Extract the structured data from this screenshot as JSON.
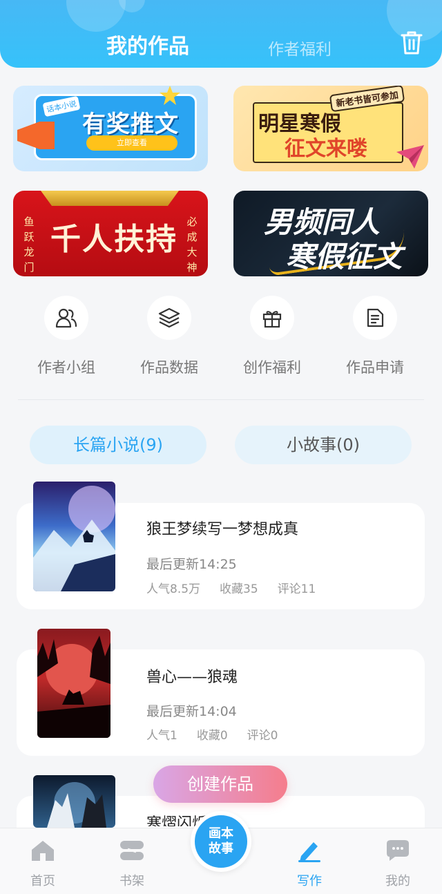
{
  "header": {
    "tab_active": "我的作品",
    "tab_inactive": "作者福利",
    "trash_icon": "trash-icon"
  },
  "banners": [
    {
      "id": "award",
      "tag": "话本小说",
      "title": "有奖推文",
      "button": "立即查看"
    },
    {
      "id": "star",
      "ribbon": "新老书皆可参加",
      "line1": "明星寒假",
      "line2": "征文来喽"
    },
    {
      "id": "support",
      "title": "千人扶持",
      "left_side": "鱼跃龙门",
      "right_side": "必成大神"
    },
    {
      "id": "fanfic",
      "line1": "男频同人",
      "line2": "寒假征文"
    }
  ],
  "features": [
    {
      "label": "作者小组",
      "icon": "users-icon"
    },
    {
      "label": "作品数据",
      "icon": "layers-icon"
    },
    {
      "label": "创作福利",
      "icon": "gift-icon"
    },
    {
      "label": "作品申请",
      "icon": "document-icon"
    }
  ],
  "categories": [
    {
      "label": "长篇小说(9)",
      "active": true
    },
    {
      "label": "小故事(0)",
      "active": false
    }
  ],
  "works": [
    {
      "title": "狼王梦续写一梦想成真",
      "updated": "最后更新14:25",
      "popularity": "人气8.5万",
      "favorites": "收藏35",
      "comments": "评论11"
    },
    {
      "title": "兽心——狼魂",
      "updated": "最后更新14:04",
      "popularity": "人气1",
      "favorites": "收藏0",
      "comments": "评论0"
    },
    {
      "title": "寒熠闪烁"
    }
  ],
  "create_button": "创建作品",
  "bottom_nav": {
    "items": [
      {
        "label": "首页",
        "icon": "home-icon"
      },
      {
        "label": "书架",
        "icon": "bookshelf-icon"
      },
      {
        "label": "写作",
        "icon": "pen-icon",
        "active": true
      },
      {
        "label": "我的",
        "icon": "chat-icon"
      }
    ],
    "center_line1": "画本",
    "center_line2": "故事"
  },
  "colors": {
    "accent": "#2aa4f2",
    "header": "#47b8f5"
  }
}
